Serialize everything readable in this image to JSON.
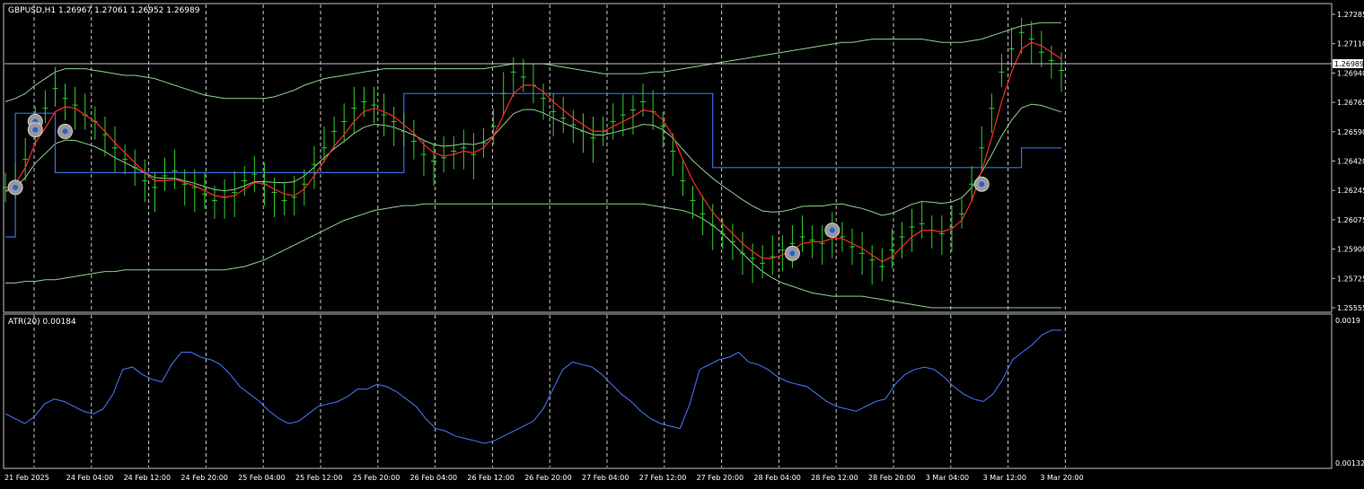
{
  "symbol_header": "GBPUSD,H1  1.26967 1.27061 1.26952 1.26989",
  "atr_header": "ATR(20) 0.00184",
  "colors": {
    "background": "#000000",
    "candle": "#33cc33",
    "ma_red": "#ff2a2a",
    "band_green": "#8fd18f",
    "step_blue": "#3b6fe0",
    "atr_blue": "#4a78ff",
    "grid": "#c8c8c8"
  },
  "chart_data": [
    {
      "type": "line",
      "title": "GBPUSD,H1",
      "price_axis_ticks": [
        "1.27285",
        "1.27110",
        "1.26940",
        "1.26765",
        "1.26590",
        "1.26420",
        "1.26245",
        "1.26075",
        "1.25900",
        "1.25725",
        "1.25555"
      ],
      "current_price_label": "1.26989",
      "ylim": [
        1.2555,
        1.2733
      ],
      "x_tick_labels": [
        "21 Feb 2025",
        "24 Feb 04:00",
        "24 Feb 12:00",
        "24 Feb 20:00",
        "25 Feb 04:00",
        "25 Feb 12:00",
        "25 Feb 20:00",
        "26 Feb 04:00",
        "26 Feb 12:00",
        "26 Feb 20:00",
        "27 Feb 04:00",
        "27 Feb 12:00",
        "27 Feb 20:00",
        "28 Feb 04:00",
        "28 Feb 12:00",
        "28 Feb 20:00",
        "3 Mar 04:00",
        "3 Mar 12:00",
        "3 Mar 20:00"
      ],
      "close_series": [
        1.2628,
        1.2632,
        1.2645,
        1.2668,
        1.2676,
        1.2688,
        1.2682,
        1.2678,
        1.2672,
        1.2668,
        1.266,
        1.2652,
        1.2645,
        1.264,
        1.2632,
        1.2628,
        1.2635,
        1.2638,
        1.263,
        1.2628,
        1.2624,
        1.262,
        1.2622,
        1.2625,
        1.2632,
        1.2636,
        1.263,
        1.2625,
        1.262,
        1.2622,
        1.263,
        1.2642,
        1.2652,
        1.2662,
        1.2668,
        1.2676,
        1.268,
        1.2678,
        1.2672,
        1.2668,
        1.2662,
        1.2656,
        1.2648,
        1.2644,
        1.2646,
        1.265,
        1.2652,
        1.2648,
        1.2655,
        1.2665,
        1.2685,
        1.2698,
        1.2695,
        1.269,
        1.2682,
        1.2674,
        1.267,
        1.2666,
        1.2662,
        1.2658,
        1.2662,
        1.2668,
        1.2672,
        1.2675,
        1.268,
        1.2674,
        1.2665,
        1.265,
        1.2632,
        1.262,
        1.2612,
        1.2605,
        1.26,
        1.2595,
        1.2588,
        1.2585,
        1.2582,
        1.2586,
        1.259,
        1.2594,
        1.2598,
        1.2596,
        1.2594,
        1.26,
        1.2598,
        1.2592,
        1.2588,
        1.2584,
        1.258,
        1.259,
        1.2598,
        1.2604,
        1.2606,
        1.2602,
        1.26,
        1.2604,
        1.2612,
        1.263,
        1.2652,
        1.2676,
        1.2698,
        1.2712,
        1.2722,
        1.2718,
        1.271,
        1.2705,
        1.2699
      ],
      "series_labels": [],
      "ma_red": [
        1.2626,
        1.263,
        1.264,
        1.2655,
        1.2664,
        1.2674,
        1.2677,
        1.2676,
        1.2672,
        1.2668,
        1.2662,
        1.2655,
        1.2649,
        1.2643,
        1.2637,
        1.2632,
        1.2632,
        1.2633,
        1.2631,
        1.2629,
        1.2626,
        1.2623,
        1.2622,
        1.2623,
        1.2627,
        1.2631,
        1.263,
        1.2627,
        1.2624,
        1.2623,
        1.2627,
        1.2635,
        1.2644,
        1.2653,
        1.266,
        1.2668,
        1.2674,
        1.2676,
        1.2674,
        1.2671,
        1.2666,
        1.2661,
        1.2654,
        1.2649,
        1.2647,
        1.2648,
        1.265,
        1.2649,
        1.2652,
        1.2659,
        1.2672,
        1.2685,
        1.269,
        1.269,
        1.2686,
        1.268,
        1.2675,
        1.267,
        1.2666,
        1.2662,
        1.2662,
        1.2665,
        1.2668,
        1.2671,
        1.2675,
        1.2674,
        1.2669,
        1.2659,
        1.2645,
        1.2632,
        1.2622,
        1.2613,
        1.2606,
        1.26,
        1.2594,
        1.2589,
        1.2585,
        1.2585,
        1.2587,
        1.259,
        1.2594,
        1.2595,
        1.2595,
        1.2597,
        1.2597,
        1.2594,
        1.2591,
        1.2587,
        1.2583,
        1.2586,
        1.2592,
        1.2598,
        1.2602,
        1.2602,
        1.2601,
        1.2603,
        1.2608,
        1.262,
        1.2638,
        1.2658,
        1.268,
        1.2698,
        1.2712,
        1.2716,
        1.2714,
        1.271,
        1.2706
      ],
      "band_upper": [
        1.268,
        1.2682,
        1.2685,
        1.269,
        1.2694,
        1.2698,
        1.27,
        1.27,
        1.27,
        1.2699,
        1.2698,
        1.2697,
        1.2696,
        1.2696,
        1.2695,
        1.2694,
        1.2692,
        1.269,
        1.2688,
        1.2686,
        1.2684,
        1.2683,
        1.2682,
        1.2682,
        1.2682,
        1.2682,
        1.2682,
        1.2683,
        1.2685,
        1.2687,
        1.269,
        1.2692,
        1.2694,
        1.2695,
        1.2696,
        1.2697,
        1.2698,
        1.2699,
        1.27,
        1.27,
        1.27,
        1.27,
        1.27,
        1.27,
        1.27,
        1.27,
        1.27,
        1.27,
        1.27,
        1.2701,
        1.2702,
        1.2703,
        1.2703,
        1.2703,
        1.2703,
        1.2702,
        1.2701,
        1.27,
        1.2699,
        1.2698,
        1.2697,
        1.2697,
        1.2697,
        1.2697,
        1.2697,
        1.2698,
        1.2698,
        1.2699,
        1.27,
        1.2701,
        1.2702,
        1.2703,
        1.2704,
        1.2705,
        1.2706,
        1.2707,
        1.2708,
        1.2709,
        1.271,
        1.2711,
        1.2712,
        1.2713,
        1.2714,
        1.2715,
        1.2716,
        1.2716,
        1.2717,
        1.2718,
        1.2718,
        1.2718,
        1.2718,
        1.2718,
        1.2718,
        1.2717,
        1.2716,
        1.2716,
        1.2716,
        1.2717,
        1.2718,
        1.272,
        1.2722,
        1.2724,
        1.2726,
        1.2727,
        1.2728,
        1.2728,
        1.2728
      ],
      "band_lower": [
        1.257,
        1.257,
        1.2571,
        1.2571,
        1.2572,
        1.2572,
        1.2573,
        1.2574,
        1.2575,
        1.2576,
        1.2577,
        1.2577,
        1.2578,
        1.2578,
        1.2578,
        1.2578,
        1.2578,
        1.2578,
        1.2578,
        1.2578,
        1.2578,
        1.2578,
        1.2578,
        1.2579,
        1.258,
        1.2582,
        1.2584,
        1.2587,
        1.259,
        1.2593,
        1.2596,
        1.2599,
        1.2602,
        1.2605,
        1.2608,
        1.261,
        1.2612,
        1.2614,
        1.2615,
        1.2616,
        1.2617,
        1.2617,
        1.2618,
        1.2618,
        1.2618,
        1.2618,
        1.2618,
        1.2618,
        1.2618,
        1.2618,
        1.2618,
        1.2618,
        1.2618,
        1.2618,
        1.2618,
        1.2618,
        1.2618,
        1.2618,
        1.2618,
        1.2618,
        1.2618,
        1.2618,
        1.2618,
        1.2618,
        1.2618,
        1.2617,
        1.2616,
        1.2615,
        1.2614,
        1.2612,
        1.2609,
        1.2605,
        1.26,
        1.2594,
        1.2588,
        1.2582,
        1.2577,
        1.2573,
        1.257,
        1.2568,
        1.2566,
        1.2564,
        1.2563,
        1.2562,
        1.2562,
        1.2562,
        1.2562,
        1.2561,
        1.256,
        1.2559,
        1.2558,
        1.2557,
        1.2556,
        1.2555,
        1.2555,
        1.2555,
        1.2555,
        1.2555,
        1.2555,
        1.2555,
        1.2555,
        1.2555,
        1.2555,
        1.2555,
        1.2555,
        1.2555,
        1.2555
      ],
      "step_levels": [
        {
          "from": 0,
          "to": 1,
          "value": 1.2598
        },
        {
          "from": 1,
          "to": 5,
          "value": 1.2673
        },
        {
          "from": 5,
          "to": 40,
          "value": 1.2637
        },
        {
          "from": 40,
          "to": 71,
          "value": 1.2685
        },
        {
          "from": 71,
          "to": 102,
          "value": 1.264
        },
        {
          "from": 102,
          "to": 132,
          "value": 1.2652
        },
        {
          "from": 132,
          "to": 131,
          "value": 1.2652
        }
      ],
      "markers": [
        {
          "i": 1,
          "value": 1.2628
        },
        {
          "i": 3,
          "value": 1.2668
        },
        {
          "i": 3,
          "value": 1.2663
        },
        {
          "i": 6,
          "value": 1.2662
        },
        {
          "i": 79,
          "value": 1.2588
        },
        {
          "i": 83,
          "value": 1.2602
        },
        {
          "i": 98,
          "value": 1.263
        }
      ]
    },
    {
      "type": "line",
      "title": "ATR(20) 0.00184",
      "y_tick_labels": [
        "0.0019",
        "0.00132"
      ],
      "ylim": [
        0.00132,
        0.0019
      ],
      "values": [
        0.00152,
        0.0015,
        0.00148,
        0.00151,
        0.00156,
        0.00158,
        0.00157,
        0.00155,
        0.00153,
        0.00152,
        0.00154,
        0.0016,
        0.0017,
        0.00171,
        0.00168,
        0.00166,
        0.00165,
        0.00172,
        0.00177,
        0.00177,
        0.00175,
        0.00174,
        0.00172,
        0.00168,
        0.00163,
        0.0016,
        0.00157,
        0.00153,
        0.0015,
        0.00148,
        0.00149,
        0.00152,
        0.00155,
        0.00156,
        0.00157,
        0.00159,
        0.00162,
        0.00162,
        0.00164,
        0.00163,
        0.00161,
        0.00158,
        0.00155,
        0.0015,
        0.00146,
        0.00145,
        0.00143,
        0.00142,
        0.00141,
        0.0014,
        0.00141,
        0.00143,
        0.00145,
        0.00147,
        0.00149,
        0.00154,
        0.00162,
        0.0017,
        0.00173,
        0.00172,
        0.00171,
        0.00168,
        0.00164,
        0.0016,
        0.00157,
        0.00153,
        0.0015,
        0.00148,
        0.00147,
        0.00146,
        0.00156,
        0.0017,
        0.00172,
        0.00174,
        0.00175,
        0.00177,
        0.00173,
        0.00172,
        0.0017,
        0.00167,
        0.00165,
        0.00164,
        0.00163,
        0.0016,
        0.00157,
        0.00155,
        0.00154,
        0.00153,
        0.00155,
        0.00157,
        0.00158,
        0.00164,
        0.00168,
        0.0017,
        0.00171,
        0.0017,
        0.00167,
        0.00163,
        0.0016,
        0.00158,
        0.00157,
        0.0016,
        0.00166,
        0.00174,
        0.00177,
        0.0018,
        0.00184,
        0.00186,
        0.00186
      ]
    }
  ]
}
